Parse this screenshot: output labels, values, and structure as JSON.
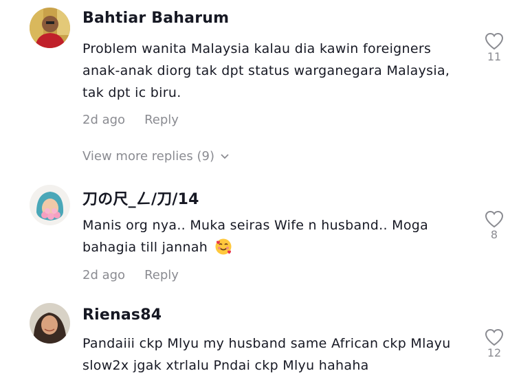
{
  "comments": [
    {
      "username": "Bahtiar Baharum",
      "text": "Problem wanita Malaysia kalau dia kawin foreigners anak-anak diorg tak dpt status warganegara Malaysia, tak dpt ic biru.",
      "time": "2d ago",
      "reply_label": "Reply",
      "likes": "11"
    },
    {
      "username": "刀の尺_ㄥ/刀/14",
      "text": "Manis org nya.. Muka seiras Wife n husband.. Moga bahagia till jannah",
      "emoji": "smiling-face-with-hearts",
      "time": "2d ago",
      "reply_label": "Reply",
      "likes": "8"
    },
    {
      "username": "Rienas84",
      "text": "Pandaiii ckp Mlyu my husband same African ckp Mlayu slow2x jgak xtrlalu Pndai ckp Mlyu hahaha",
      "likes": "12"
    }
  ],
  "view_more": {
    "label": "View more replies (9)"
  },
  "colors": {
    "text": "#161823",
    "secondary": "#8a8b91"
  }
}
